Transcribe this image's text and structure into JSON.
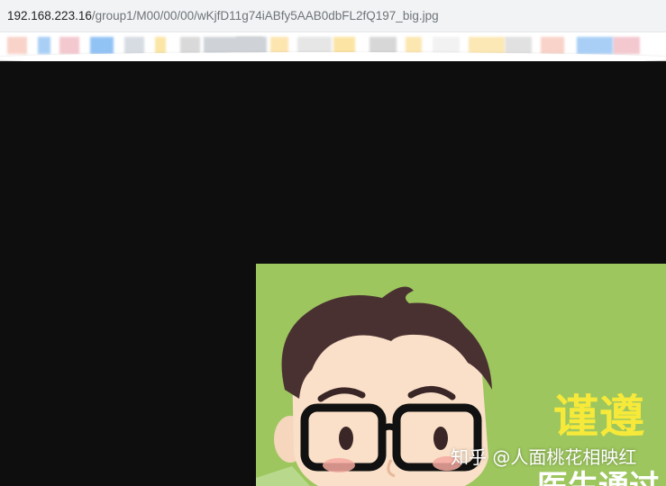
{
  "address_bar": {
    "host": "192.168.223.16",
    "path": "/group1/M00/00/00/wKjfD11g74iABfy5AAB0dbFL2fQ197_big.jpg"
  },
  "bookmarks_colors": [
    "#f9d3c9",
    "#a9cff6",
    "#f3c8cf",
    "#92c3f5",
    "#d7dce3",
    "#fbe6a6",
    "#d9d9d9",
    "#cfd3d8",
    "#c7ccd1",
    "#fde5b0",
    "#e6e6e6",
    "#fbe4a4",
    "#d7d7d7",
    "#fce7b1",
    "#f2f2f2",
    "#fce8b4",
    "#e1e1e1"
  ],
  "content_image": {
    "background": "#9dc65e",
    "headline": "谨遵",
    "subline": "医生通过"
  },
  "watermark": "知乎 @人面桃花相映红"
}
